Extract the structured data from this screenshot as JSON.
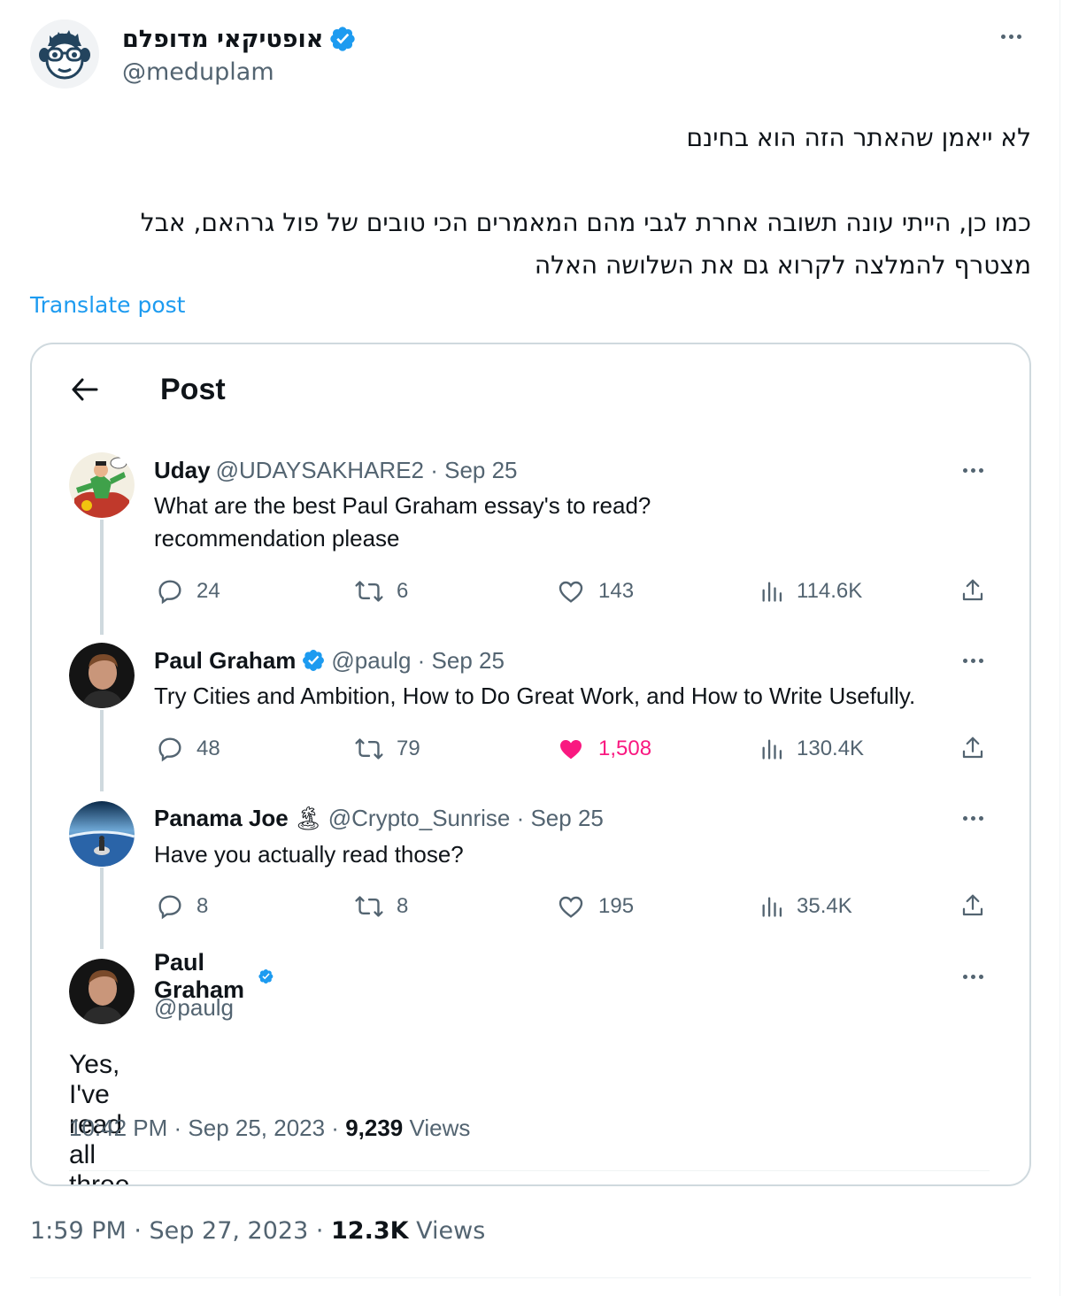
{
  "author": {
    "name": "אופטיקאי מדופלם",
    "handle": "@meduplam"
  },
  "post": {
    "line1": "לא ייאמן שהאתר הזה הוא בחינם",
    "line2": "כמו כן, הייתי עונה תשובה אחרת לגבי מהם המאמרים הכי טובים של פול גרהאם, אבל",
    "line3": "מצטרף להמלצה לקרוא גם את השלושה האלה",
    "translate": "Translate post",
    "time": "1:59 PM · Sep 27, 2023 · ",
    "views_count": "12.3K",
    "views_label": " Views"
  },
  "embed": {
    "title": "Post",
    "tweets": [
      {
        "name": "Uday",
        "handle": "@UDAYSAKHARE2 · Sep 25",
        "text1": "What are the best Paul Graham essay's to read?",
        "text2": "recommendation please",
        "replies": "24",
        "reposts": "6",
        "likes": "143",
        "views": "114.6K"
      },
      {
        "name": "Paul Graham",
        "handle": "@paulg · Sep 25",
        "text1": "Try Cities and Ambition, How to Do Great Work, and How to Write Usefully.",
        "replies": "48",
        "reposts": "79",
        "likes": "1,508",
        "views": "130.4K"
      },
      {
        "name": "Panama Joe",
        "emoji": "🏝",
        "handle": "@Crypto_Sunrise · Sep 25",
        "text1": "Have you actually read those?",
        "replies": "8",
        "reposts": "8",
        "likes": "195",
        "views": "35.4K"
      }
    ],
    "final": {
      "name": "Paul Graham",
      "handle": "@paulg",
      "text": "Yes, I've read all three.",
      "time": "10:42 PM · Sep 25, 2023 · ",
      "views_count": "9,239",
      "views_label": " Views"
    }
  },
  "colors": {
    "accent": "#1d9bf0",
    "like": "#f91880",
    "muted": "#536471",
    "text": "#0f1419"
  },
  "icons": [
    "verified-icon",
    "more-icon",
    "back-arrow-icon",
    "reply-icon",
    "repost-icon",
    "like-icon",
    "views-icon",
    "share-icon"
  ]
}
